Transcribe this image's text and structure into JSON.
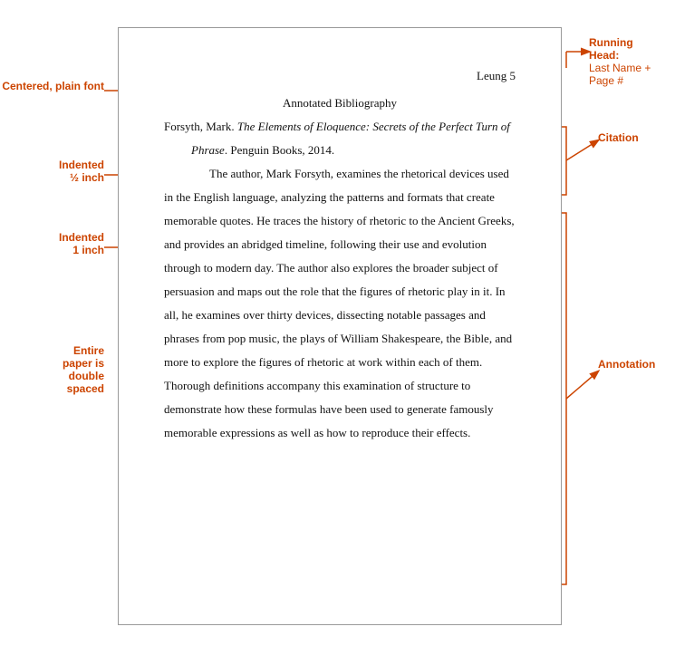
{
  "page": {
    "header_name": "Leung 5",
    "title": "Annotated Bibliography",
    "citation_text_before_italic": "Forsyth, Mark. ",
    "citation_italic": "The Elements of Eloquence: Secrets of the Perfect Turn of Phrase",
    "citation_text_after_italic": ". Penguin Books, 2014.",
    "annotation": "The author, Mark Forsyth, examines the rhetorical devices used in the English language, analyzing the patterns and formats that create memorable quotes. He traces the history of rhetoric to the Ancient Greeks, and provides an abridged timeline, following their use and evolution through to modern day. The author also explores the broader subject of persuasion and maps out the role that the figures of rhetoric play in it. In all, he examines over thirty devices, dissecting notable passages and phrases from pop music, the plays of William Shakespeare, the Bible, and more to explore the figures of rhetoric at work within each of them. Thorough definitions accompany this examination of structure to demonstrate how these formulas have been used to generate famously memorable expressions as well as how to reproduce their effects."
  },
  "labels": {
    "centered_plain": "Centered,\nplain font",
    "indented_half": "Indented\n½ inch",
    "indented_one": "Indented\n1 inch",
    "double_spaced": "Entire\npaper is\ndouble\nspaced",
    "running_head": "Running\nHead:\nLast Name +\nPage #",
    "citation": "Citation",
    "annotation": "Annotation"
  }
}
